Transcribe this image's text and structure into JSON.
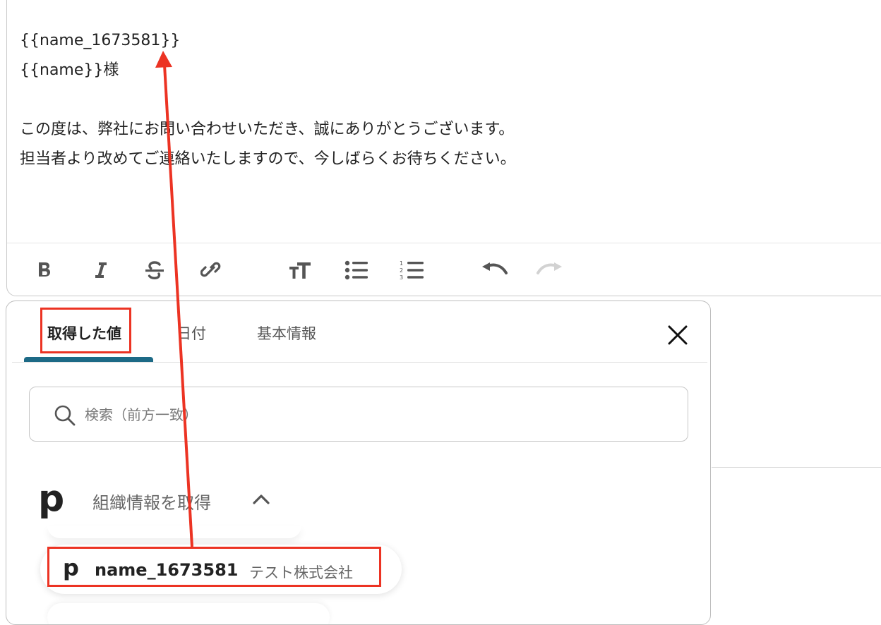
{
  "editor": {
    "lines": [
      "{{name_1673581}}",
      "{{name}}様",
      "",
      "この度は、弊社にお問い合わせいただき、誠にありがとうございます。",
      "担当者より改めてご連絡いたしますので、今しばらくお待ちください。"
    ]
  },
  "toolbar": {
    "buttons": [
      "bold-icon",
      "italic-icon",
      "strikethrough-icon",
      "link-icon",
      "text-size-icon",
      "bullet-list-icon",
      "numbered-list-icon",
      "undo-icon",
      "redo-icon"
    ]
  },
  "panel": {
    "tabs": [
      {
        "label": "取得した値",
        "active": true
      },
      {
        "label": "日付",
        "active": false
      },
      {
        "label": "基本情報",
        "active": false
      }
    ],
    "search_placeholder": "検索（前方一致）",
    "group": {
      "logo": "p",
      "label": "組織情報を取得"
    },
    "item": {
      "logo": "p",
      "name": "name_1673581",
      "value": "テスト株式会社"
    }
  },
  "colors": {
    "accent": "#1d6a86",
    "annotation": "#ec3323"
  }
}
